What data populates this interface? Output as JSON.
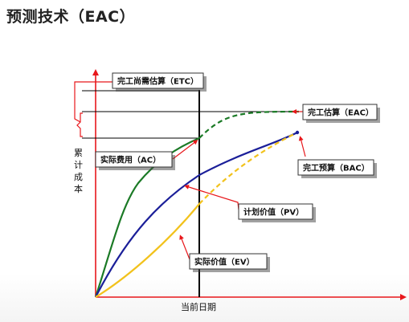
{
  "title": "预测技术（EAC）",
  "labels": {
    "etc": "完工尚需估算（ETC）",
    "eac": "完工估算（EAC）",
    "ac": "实际费用（AC）",
    "bac": "完工预算（BAC）",
    "pv": "计划价值（PV）",
    "ev": "实际价值（EV）",
    "y_axis_chars": [
      "累",
      "计",
      "成",
      "本"
    ],
    "x_axis": "当前日期"
  },
  "colors": {
    "axis": "#e8171b",
    "ac_curve": "#1b7a26",
    "pv_curve": "#1b1f99",
    "ev_curve": "#f2c21c",
    "current_date_line": "#000000",
    "guide_line": "#000000"
  }
}
